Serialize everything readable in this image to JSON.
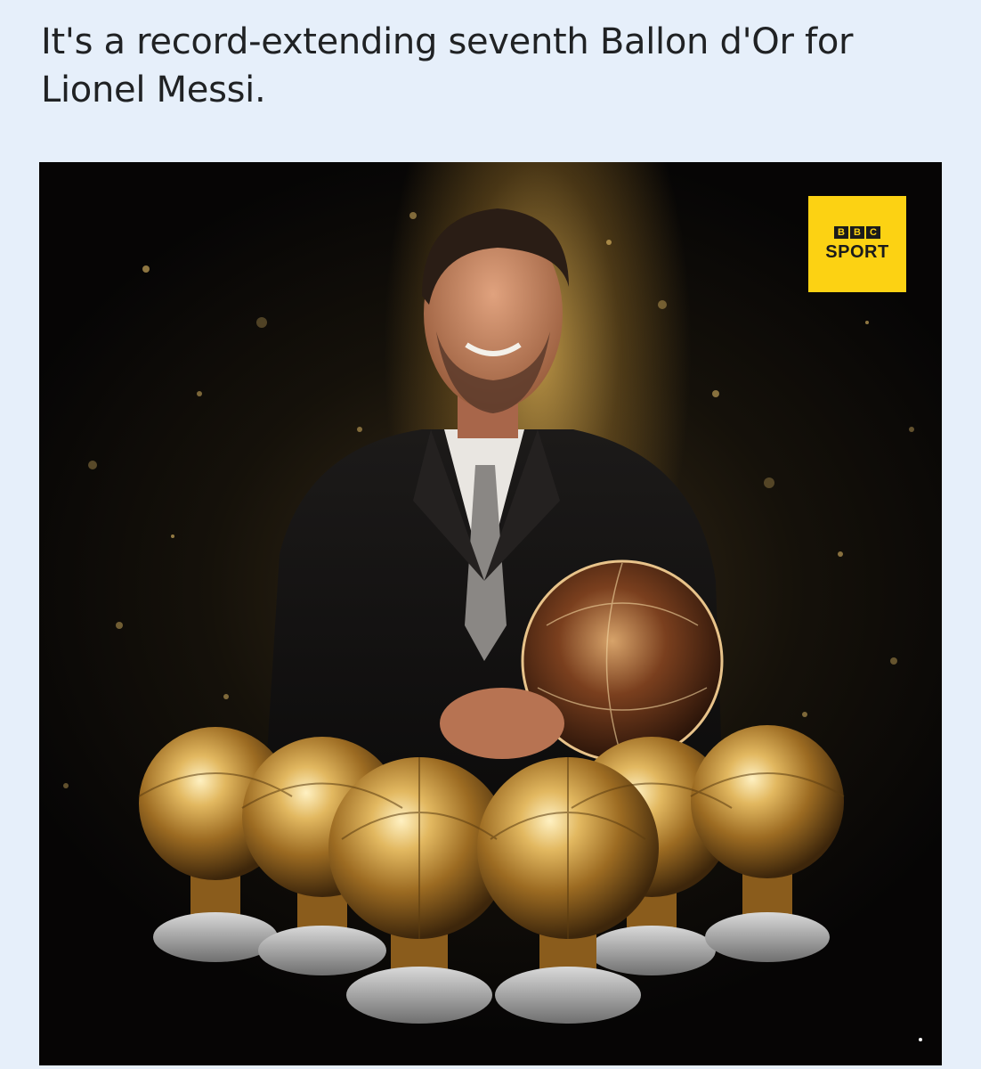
{
  "post": {
    "headline": "It's a record-extending seventh Ballon d'Or for Lionel Messi."
  },
  "image": {
    "badge": {
      "brand_letters": [
        "B",
        "B",
        "C"
      ],
      "label": "SPORT"
    }
  },
  "colors": {
    "page_background": "#e6effa",
    "badge_yellow": "#fcd213",
    "trophy_gold": "#c99a3a"
  }
}
